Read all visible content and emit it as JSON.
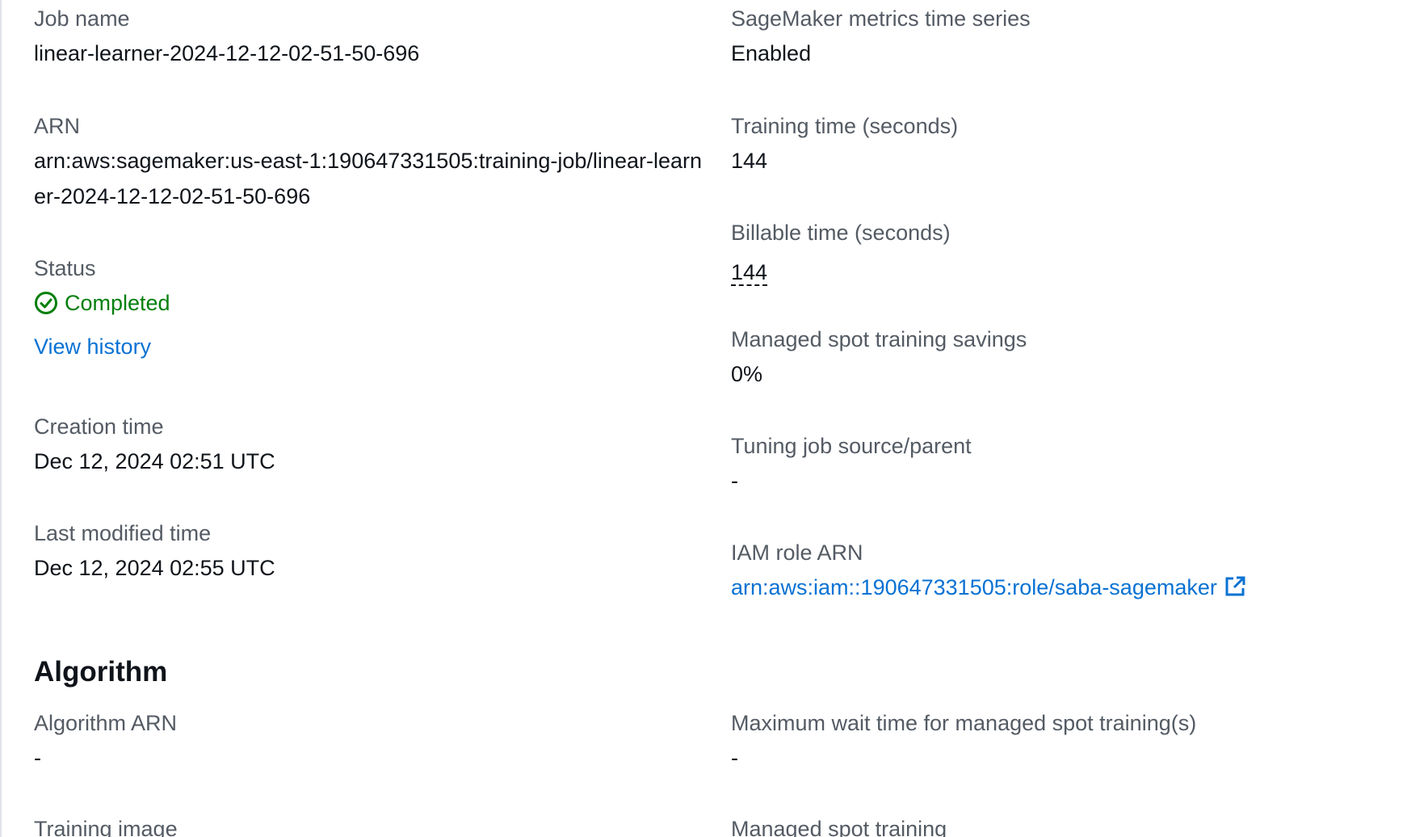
{
  "details": {
    "job_name": {
      "label": "Job name",
      "value": "linear-learner-2024-12-12-02-51-50-696"
    },
    "arn": {
      "label": "ARN",
      "value": "arn:aws:sagemaker:us-east-1:190647331505:training-job/linear-learner-2024-12-12-02-51-50-696"
    },
    "status": {
      "label": "Status",
      "value": "Completed",
      "icon": "check-circle-icon",
      "color": "#037f0c",
      "history_link": "View history"
    },
    "creation_time": {
      "label": "Creation time",
      "value": "Dec 12, 2024 02:51 UTC"
    },
    "last_modified_time": {
      "label": "Last modified time",
      "value": "Dec 12, 2024 02:55 UTC"
    },
    "metrics_time_series": {
      "label": "SageMaker metrics time series",
      "value": "Enabled"
    },
    "training_time": {
      "label": "Training time (seconds)",
      "value": "144"
    },
    "billable_time": {
      "label": "Billable time (seconds)",
      "value": "144"
    },
    "spot_savings": {
      "label": "Managed spot training savings",
      "value": "0%"
    },
    "tuning_job": {
      "label": "Tuning job source/parent",
      "value": "-"
    },
    "iam_role": {
      "label": "IAM role ARN",
      "value": "arn:aws:iam::190647331505:role/saba-sagemaker",
      "icon": "external-link-icon"
    }
  },
  "algorithm": {
    "title": "Algorithm",
    "algorithm_arn": {
      "label": "Algorithm ARN",
      "value": "-"
    },
    "max_wait_time": {
      "label": "Maximum wait time for managed spot training(s)",
      "value": "-"
    },
    "training_image": {
      "label": "Training image"
    },
    "managed_spot": {
      "label": "Managed spot training"
    }
  },
  "colors": {
    "label": "#545b64",
    "value": "#0f141a",
    "link": "#0972d3",
    "success": "#037f0c"
  }
}
